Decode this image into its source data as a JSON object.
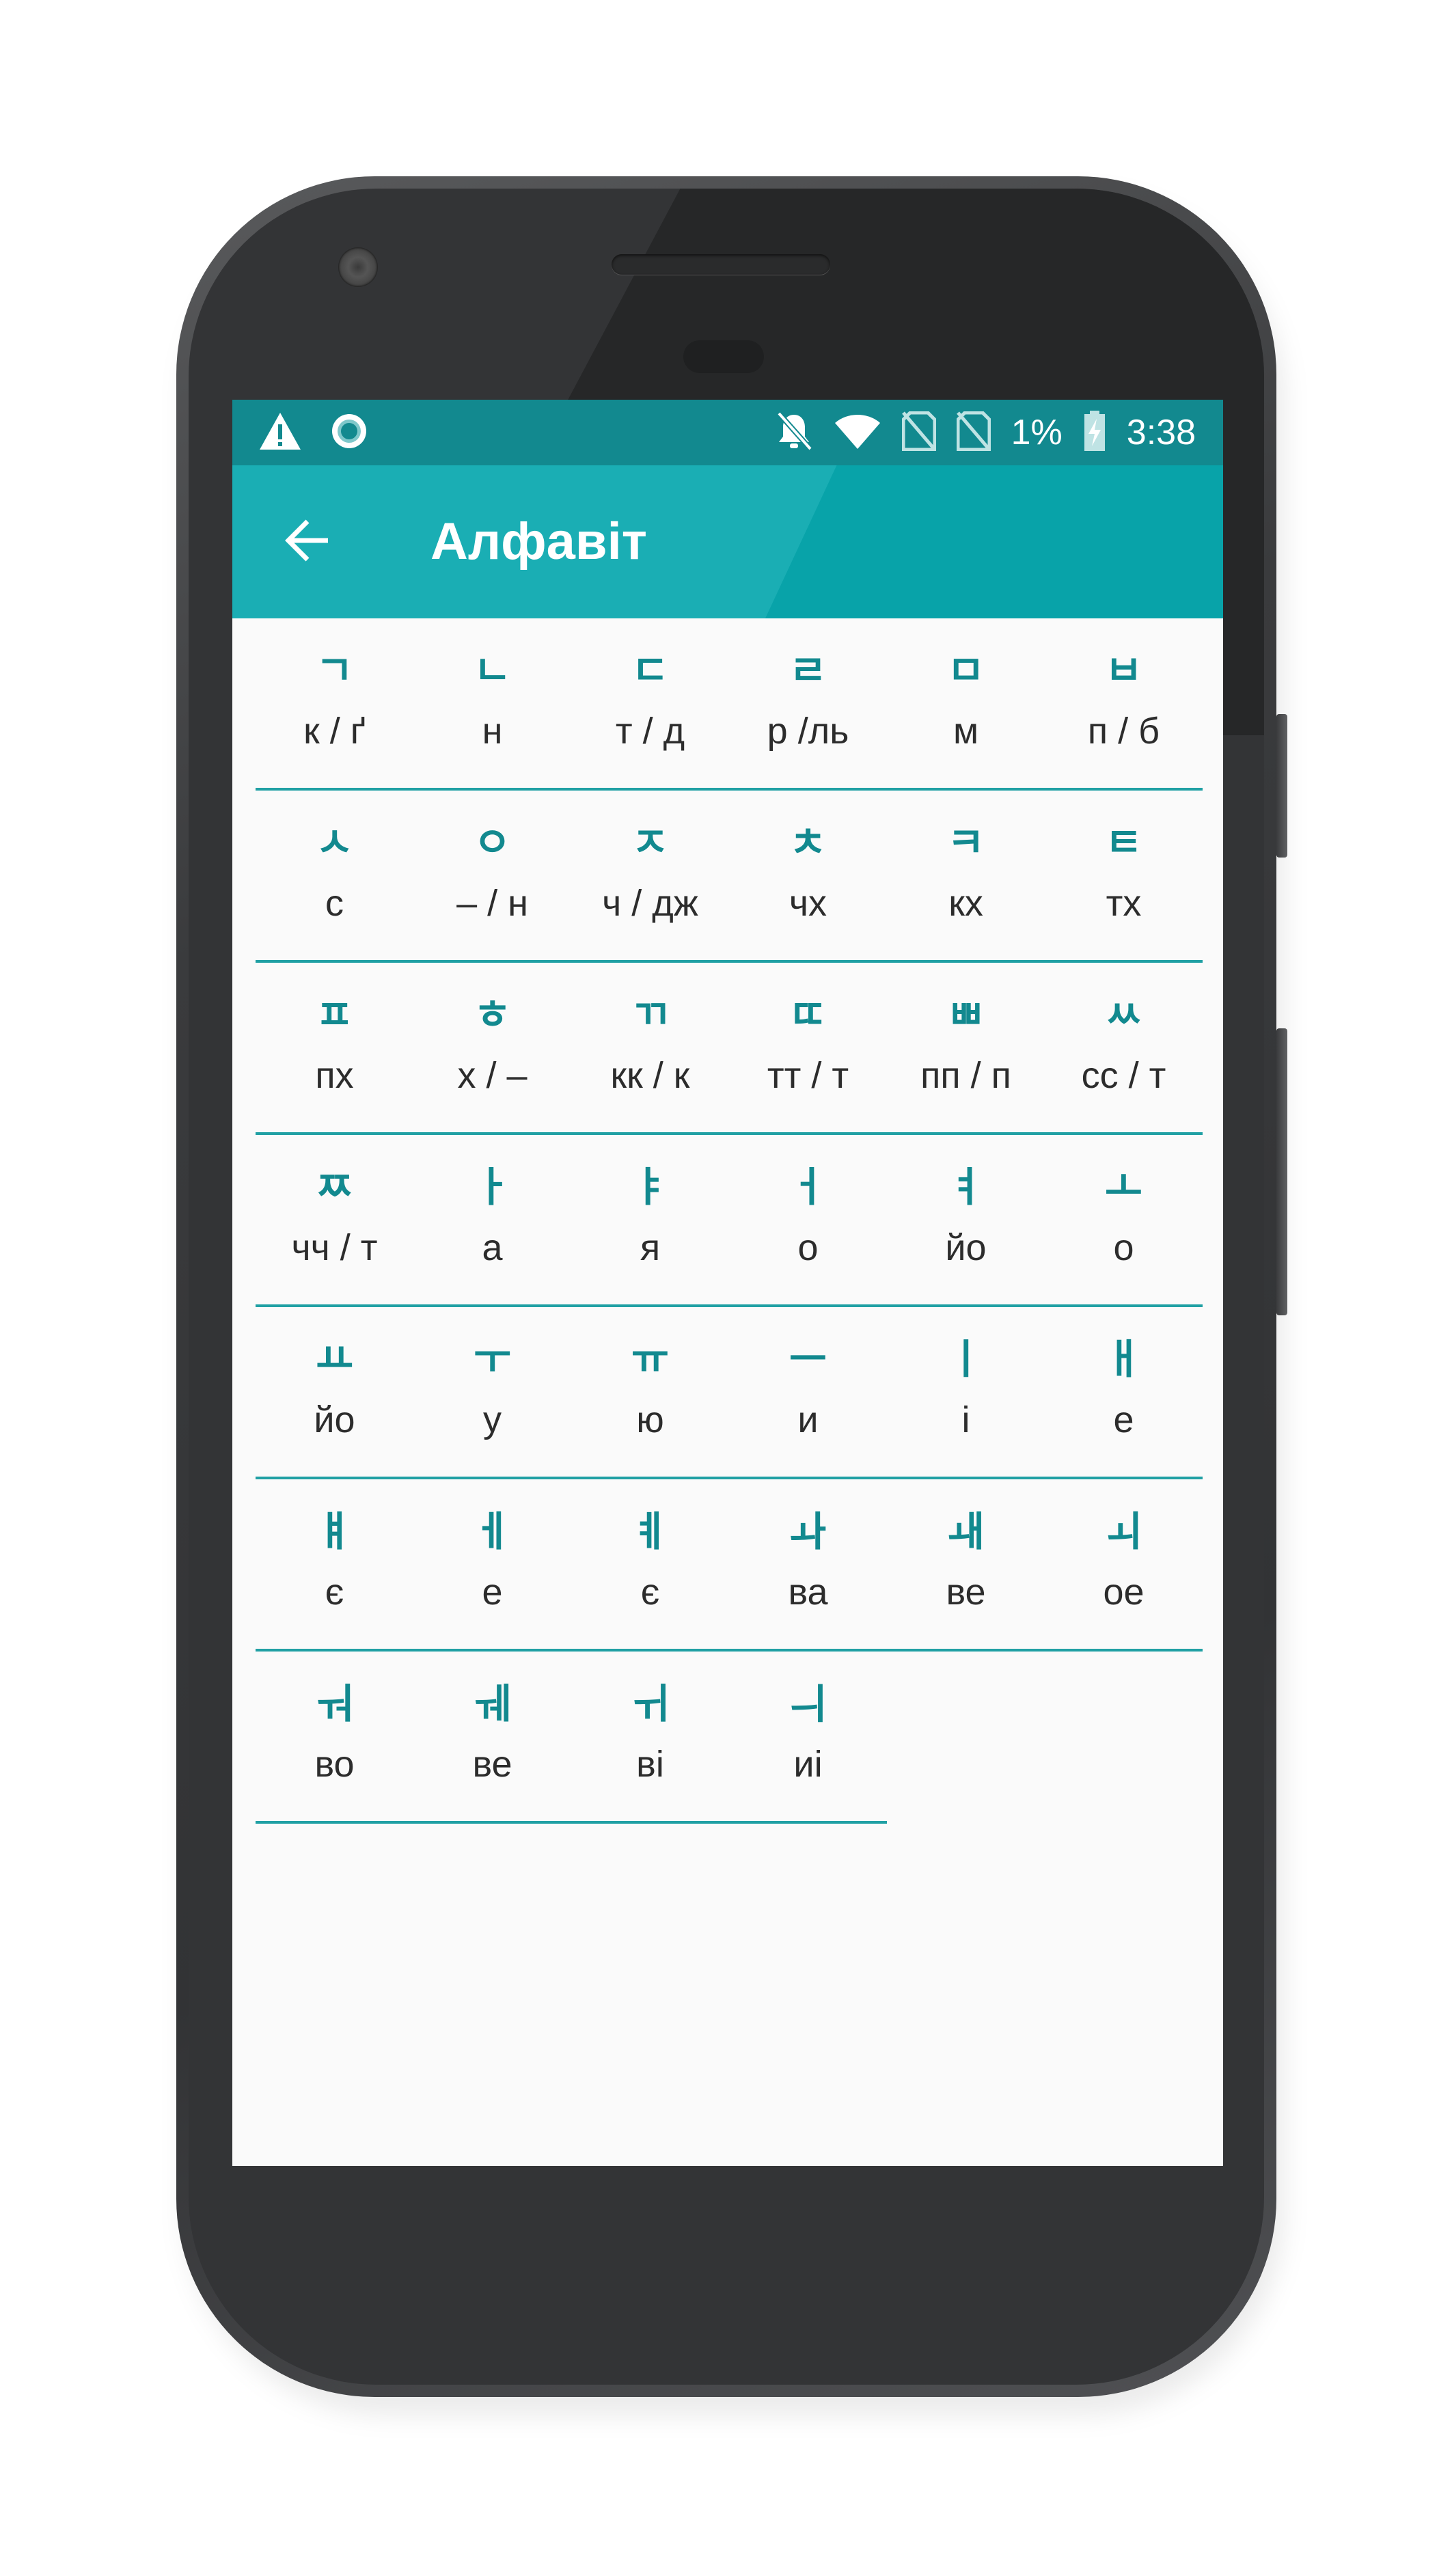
{
  "colors": {
    "status_bar": "#12898f",
    "app_bar": "#08a3a9",
    "accent": "#12898f",
    "divider": "#20a0a4",
    "text": "#2c2c2c"
  },
  "status_bar": {
    "left_icons": [
      "warning-icon",
      "circle-status-icon"
    ],
    "right_icons": [
      "notifications-off-icon",
      "wifi-icon",
      "no-sim-icon",
      "no-sim-icon",
      "battery-charging-icon"
    ],
    "battery": "1%",
    "time": "3:38"
  },
  "app_bar": {
    "back_icon": "arrow-back-icon",
    "title": "Алфавіт"
  },
  "alphabet": [
    [
      {
        "hangul": "ㄱ",
        "translit": "к / ґ"
      },
      {
        "hangul": "ㄴ",
        "translit": "н"
      },
      {
        "hangul": "ㄷ",
        "translit": "т / д"
      },
      {
        "hangul": "ㄹ",
        "translit": "р /ль"
      },
      {
        "hangul": "ㅁ",
        "translit": "м"
      },
      {
        "hangul": "ㅂ",
        "translit": "п / б"
      }
    ],
    [
      {
        "hangul": "ㅅ",
        "translit": "с"
      },
      {
        "hangul": "ㅇ",
        "translit": "– / н"
      },
      {
        "hangul": "ㅈ",
        "translit": "ч / дж"
      },
      {
        "hangul": "ㅊ",
        "translit": "чх"
      },
      {
        "hangul": "ㅋ",
        "translit": "кх"
      },
      {
        "hangul": "ㅌ",
        "translit": "тх"
      }
    ],
    [
      {
        "hangul": "ㅍ",
        "translit": "пх"
      },
      {
        "hangul": "ㅎ",
        "translit": "х / –"
      },
      {
        "hangul": "ㄲ",
        "translit": "кк / к"
      },
      {
        "hangul": "ㄸ",
        "translit": "тт / т"
      },
      {
        "hangul": "ㅃ",
        "translit": "пп / п"
      },
      {
        "hangul": "ㅆ",
        "translit": "сс / т"
      }
    ],
    [
      {
        "hangul": "ㅉ",
        "translit": "чч / т"
      },
      {
        "hangul": "ㅏ",
        "translit": "а"
      },
      {
        "hangul": "ㅑ",
        "translit": "я"
      },
      {
        "hangul": "ㅓ",
        "translit": "о"
      },
      {
        "hangul": "ㅕ",
        "translit": "йо"
      },
      {
        "hangul": "ㅗ",
        "translit": "о"
      }
    ],
    [
      {
        "hangul": "ㅛ",
        "translit": "йо"
      },
      {
        "hangul": "ㅜ",
        "translit": "у"
      },
      {
        "hangul": "ㅠ",
        "translit": "ю"
      },
      {
        "hangul": "ㅡ",
        "translit": "и"
      },
      {
        "hangul": "ㅣ",
        "translit": "і"
      },
      {
        "hangul": "ㅐ",
        "translit": "е"
      }
    ],
    [
      {
        "hangul": "ㅒ",
        "translit": "є"
      },
      {
        "hangul": "ㅔ",
        "translit": "е"
      },
      {
        "hangul": "ㅖ",
        "translit": "є"
      },
      {
        "hangul": "ㅘ",
        "translit": "ва"
      },
      {
        "hangul": "ㅙ",
        "translit": "ве"
      },
      {
        "hangul": "ㅚ",
        "translit": "ое"
      }
    ],
    [
      {
        "hangul": "ㅝ",
        "translit": "во"
      },
      {
        "hangul": "ㅞ",
        "translit": "ве"
      },
      {
        "hangul": "ㅟ",
        "translit": "ві"
      },
      {
        "hangul": "ㅢ",
        "translit": "иі"
      }
    ]
  ]
}
